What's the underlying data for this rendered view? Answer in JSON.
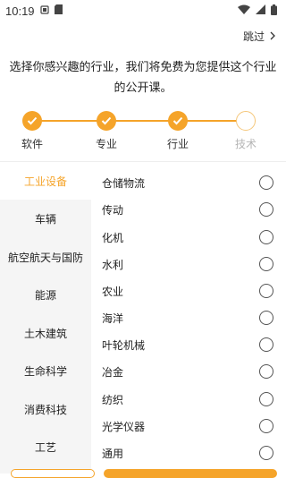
{
  "status_bar": {
    "time": "10:19"
  },
  "header": {
    "skip_label": "跳过"
  },
  "headline": {
    "line1": "选择你感兴趣的行业，我们将免费为您提供这个行业",
    "line2": "的公开课。"
  },
  "stepper": {
    "steps": [
      {
        "label": "软件",
        "state": "done"
      },
      {
        "label": "专业",
        "state": "done"
      },
      {
        "label": "行业",
        "state": "done"
      },
      {
        "label": "技术",
        "state": "todo"
      }
    ]
  },
  "sidebar": {
    "items": [
      {
        "label": "工业设备",
        "active": true
      },
      {
        "label": "车辆",
        "active": false
      },
      {
        "label": "航空航天与国防",
        "active": false
      },
      {
        "label": "能源",
        "active": false
      },
      {
        "label": "土木建筑",
        "active": false
      },
      {
        "label": "生命科学",
        "active": false
      },
      {
        "label": "消费科技",
        "active": false
      },
      {
        "label": "工艺",
        "active": false
      }
    ]
  },
  "options": {
    "items": [
      {
        "label": "仓储物流",
        "selected": false
      },
      {
        "label": "传动",
        "selected": false
      },
      {
        "label": "化机",
        "selected": false
      },
      {
        "label": "水利",
        "selected": false
      },
      {
        "label": "农业",
        "selected": false
      },
      {
        "label": "海洋",
        "selected": false
      },
      {
        "label": "叶轮机械",
        "selected": false
      },
      {
        "label": "冶金",
        "selected": false
      },
      {
        "label": "纺织",
        "selected": false
      },
      {
        "label": "光学仪器",
        "selected": false
      },
      {
        "label": "通用",
        "selected": false
      }
    ]
  },
  "colors": {
    "accent": "#f5a42a",
    "sidebar_bg": "#f5f5f5",
    "muted_text": "#b5b5b5"
  }
}
